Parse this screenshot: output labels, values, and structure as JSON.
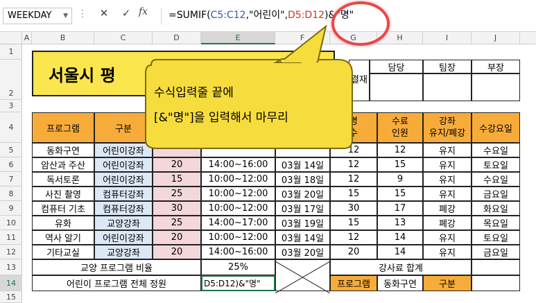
{
  "formula_bar": {
    "name_box": "WEEKDAY",
    "fx": "fx",
    "formula_parts": [
      "=SUMIF(",
      "C5:C12",
      ",\"어린이\",",
      "D5:D12",
      ")&\"명\""
    ]
  },
  "columns": [
    "A",
    "B",
    "C",
    "D",
    "E",
    "F",
    "G",
    "H",
    "I",
    "J"
  ],
  "rows": [
    "1",
    "2",
    "3",
    "4",
    "5",
    "6",
    "7",
    "8",
    "9",
    "10",
    "11",
    "12",
    "13",
    "14",
    "15"
  ],
  "title": "서울시 평",
  "approval": {
    "side_label": "결재",
    "headers": [
      "담당",
      "팀장",
      "부장"
    ]
  },
  "table": {
    "headers": [
      "프로그램",
      "구분",
      "",
      "",
      "",
      "명\n수",
      "수료\n인원",
      "강좌\n유지/폐강",
      "수강요일"
    ],
    "rows": [
      [
        "동화구연",
        "어린이강좌",
        "",
        "",
        "",
        "12",
        "12",
        "유지",
        "수요일"
      ],
      [
        "암산과 주산",
        "어린이강좌",
        "20",
        "14:00~16:00",
        "03월 14일",
        "12",
        "15",
        "유지",
        "토요일"
      ],
      [
        "독서토론",
        "어린이강좌",
        "15",
        "10:00~12:00",
        "03월 18일",
        "12",
        "9",
        "유지",
        "수요일"
      ],
      [
        "사진 촬영",
        "컴퓨터강좌",
        "25",
        "10:00~12:00",
        "03월 20일",
        "15",
        "15",
        "유지",
        "금요일"
      ],
      [
        "컴퓨터 기초",
        "컴퓨터강좌",
        "30",
        "10:00~12:00",
        "03월 17일",
        "30",
        "17",
        "폐강",
        "화요일"
      ],
      [
        "유화",
        "교양강좌",
        "25",
        "14:00~17:00",
        "03월 19일",
        "15",
        "13",
        "폐강",
        "목요일"
      ],
      [
        "역사 알기",
        "어린이강좌",
        "20",
        "10:00~12:00",
        "03월 14일",
        "12",
        "14",
        "유지",
        "토요일"
      ],
      [
        "기타교실",
        "교양강좌",
        "20",
        "14:00~16:00",
        "03월 20일",
        "20",
        "14",
        "유지",
        "금요일"
      ]
    ]
  },
  "row13": {
    "label": "교양 프로그램 비율",
    "value": "25%",
    "fee_label": "강사료 합계"
  },
  "row14": {
    "label": "어린이 프로그램 전체 정원",
    "edit": "D5:D12)&\"명\"",
    "program": "프로그램",
    "program_value": "동화구연",
    "kind": "구분"
  },
  "callout": {
    "line1": "수식입력줄  끝에",
    "line2": "[&\"명\"]을  입력해서  마무리"
  },
  "colors": {
    "orange": "#f7ac3a",
    "title_yellow": "#fbe64d",
    "callout_yellow": "#f6dc3c",
    "highlight_red": "#e9464a",
    "excel_green": "#217346"
  }
}
